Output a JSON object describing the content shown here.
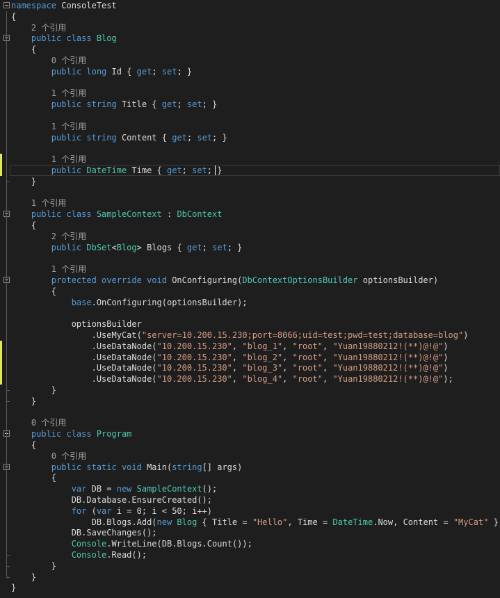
{
  "editor": {
    "lines": [
      [
        [
          "kw",
          "namespace"
        ],
        [
          "pl",
          " ConsoleTest"
        ]
      ],
      [
        [
          "pl",
          "{"
        ]
      ],
      [
        [
          "lens",
          "    2 个引用"
        ]
      ],
      [
        [
          "kw",
          "    public class "
        ],
        [
          "ty",
          "Blog"
        ]
      ],
      [
        [
          "pl",
          "    {"
        ]
      ],
      [
        [
          "lens",
          "        0 个引用"
        ]
      ],
      [
        [
          "kw",
          "        public long "
        ],
        [
          "pl",
          "Id { "
        ],
        [
          "kw",
          "get"
        ],
        [
          "pl",
          "; "
        ],
        [
          "kw",
          "set"
        ],
        [
          "pl",
          "; }"
        ]
      ],
      [
        [
          "pl",
          ""
        ]
      ],
      [
        [
          "lens",
          "        1 个引用"
        ]
      ],
      [
        [
          "kw",
          "        public string "
        ],
        [
          "pl",
          "Title { "
        ],
        [
          "kw",
          "get"
        ],
        [
          "pl",
          "; "
        ],
        [
          "kw",
          "set"
        ],
        [
          "pl",
          "; }"
        ]
      ],
      [
        [
          "pl",
          ""
        ]
      ],
      [
        [
          "lens",
          "        1 个引用"
        ]
      ],
      [
        [
          "kw",
          "        public string "
        ],
        [
          "pl",
          "Content { "
        ],
        [
          "kw",
          "get"
        ],
        [
          "pl",
          "; "
        ],
        [
          "kw",
          "set"
        ],
        [
          "pl",
          "; }"
        ]
      ],
      [
        [
          "pl",
          ""
        ]
      ],
      [
        [
          "lens",
          "        1 个引用"
        ]
      ],
      [
        [
          "kw",
          "        public "
        ],
        [
          "ty",
          "DateTime"
        ],
        [
          "pl",
          " Time { "
        ],
        [
          "kw",
          "get"
        ],
        [
          "pl",
          "; "
        ],
        [
          "kw",
          "set"
        ],
        [
          "pl",
          "; }"
        ]
      ],
      [
        [
          "pl",
          "    }"
        ]
      ],
      [
        [
          "pl",
          ""
        ]
      ],
      [
        [
          "lens",
          "    1 个引用"
        ]
      ],
      [
        [
          "kw",
          "    public class "
        ],
        [
          "ty",
          "SampleContext"
        ],
        [
          "pl",
          " : "
        ],
        [
          "ty",
          "DbContext"
        ]
      ],
      [
        [
          "pl",
          "    {"
        ]
      ],
      [
        [
          "lens",
          "        2 个引用"
        ]
      ],
      [
        [
          "kw",
          "        public "
        ],
        [
          "ty",
          "DbSet"
        ],
        [
          "pl",
          "<"
        ],
        [
          "ty",
          "Blog"
        ],
        [
          "pl",
          "> Blogs { "
        ],
        [
          "kw",
          "get"
        ],
        [
          "pl",
          "; "
        ],
        [
          "kw",
          "set"
        ],
        [
          "pl",
          "; }"
        ]
      ],
      [
        [
          "pl",
          ""
        ]
      ],
      [
        [
          "lens",
          "        1 个引用"
        ]
      ],
      [
        [
          "kw",
          "        protected override void "
        ],
        [
          "pl",
          "OnConfiguring("
        ],
        [
          "ty",
          "DbContextOptionsBuilder"
        ],
        [
          "pl",
          " optionsBuilder)"
        ]
      ],
      [
        [
          "pl",
          "        {"
        ]
      ],
      [
        [
          "kw",
          "            base"
        ],
        [
          "pl",
          ".OnConfiguring(optionsBuilder);"
        ]
      ],
      [
        [
          "pl",
          ""
        ]
      ],
      [
        [
          "pl",
          "            optionsBuilder"
        ]
      ],
      [
        [
          "pl",
          "                .UseMyCat("
        ],
        [
          "st",
          "\"server=10.200.15.230;port=8066;uid=test;pwd=test;database=blog\""
        ],
        [
          "pl",
          ")"
        ]
      ],
      [
        [
          "pl",
          "                .UseDataNode("
        ],
        [
          "st",
          "\"10.200.15.230\""
        ],
        [
          "pl",
          ", "
        ],
        [
          "st",
          "\"blog_1\""
        ],
        [
          "pl",
          ", "
        ],
        [
          "st",
          "\"root\""
        ],
        [
          "pl",
          ", "
        ],
        [
          "st",
          "\"Yuan19880212!(**)@!@\""
        ],
        [
          "pl",
          ")"
        ]
      ],
      [
        [
          "pl",
          "                .UseDataNode("
        ],
        [
          "st",
          "\"10.200.15.230\""
        ],
        [
          "pl",
          ", "
        ],
        [
          "st",
          "\"blog_2\""
        ],
        [
          "pl",
          ", "
        ],
        [
          "st",
          "\"root\""
        ],
        [
          "pl",
          ", "
        ],
        [
          "st",
          "\"Yuan19880212!(**)@!@\""
        ],
        [
          "pl",
          ")"
        ]
      ],
      [
        [
          "pl",
          "                .UseDataNode("
        ],
        [
          "st",
          "\"10.200.15.230\""
        ],
        [
          "pl",
          ", "
        ],
        [
          "st",
          "\"blog_3\""
        ],
        [
          "pl",
          ", "
        ],
        [
          "st",
          "\"root\""
        ],
        [
          "pl",
          ", "
        ],
        [
          "st",
          "\"Yuan19880212!(**)@!@\""
        ],
        [
          "pl",
          ")"
        ]
      ],
      [
        [
          "pl",
          "                .UseDataNode("
        ],
        [
          "st",
          "\"10.200.15.230\""
        ],
        [
          "pl",
          ", "
        ],
        [
          "st",
          "\"blog_4\""
        ],
        [
          "pl",
          ", "
        ],
        [
          "st",
          "\"root\""
        ],
        [
          "pl",
          ", "
        ],
        [
          "st",
          "\"Yuan19880212!(**)@!@\""
        ],
        [
          "pl",
          ");"
        ]
      ],
      [
        [
          "pl",
          "        }"
        ]
      ],
      [
        [
          "pl",
          "    }"
        ]
      ],
      [
        [
          "pl",
          ""
        ]
      ],
      [
        [
          "lens",
          "    0 个引用"
        ]
      ],
      [
        [
          "kw",
          "    public class "
        ],
        [
          "ty",
          "Program"
        ]
      ],
      [
        [
          "pl",
          "    {"
        ]
      ],
      [
        [
          "lens",
          "        0 个引用"
        ]
      ],
      [
        [
          "kw",
          "        public static void "
        ],
        [
          "pl",
          "Main("
        ],
        [
          "kw",
          "string"
        ],
        [
          "pl",
          "[] args)"
        ]
      ],
      [
        [
          "pl",
          "        {"
        ]
      ],
      [
        [
          "kw",
          "            var "
        ],
        [
          "pl",
          "DB = "
        ],
        [
          "kw",
          "new "
        ],
        [
          "ty",
          "SampleContext"
        ],
        [
          "pl",
          "();"
        ]
      ],
      [
        [
          "pl",
          "            DB.Database.EnsureCreated();"
        ]
      ],
      [
        [
          "kw",
          "            for "
        ],
        [
          "pl",
          "("
        ],
        [
          "kw",
          "var"
        ],
        [
          "pl",
          " i = 0; i < 50; i++)"
        ]
      ],
      [
        [
          "pl",
          "                DB.Blogs.Add("
        ],
        [
          "kw",
          "new "
        ],
        [
          "ty",
          "Blog"
        ],
        [
          "pl",
          " { Title = "
        ],
        [
          "st",
          "\"Hello\""
        ],
        [
          "pl",
          ", Time = "
        ],
        [
          "ty",
          "DateTime"
        ],
        [
          "pl",
          ".Now, Content = "
        ],
        [
          "st",
          "\"MyCat\""
        ],
        [
          "pl",
          " });"
        ]
      ],
      [
        [
          "pl",
          "            DB.SaveChanges();"
        ]
      ],
      [
        [
          "ty",
          "            Console"
        ],
        [
          "pl",
          ".WriteLine(DB.Blogs.Count());"
        ]
      ],
      [
        [
          "ty",
          "            Console"
        ],
        [
          "pl",
          ".Read();"
        ]
      ],
      [
        [
          "pl",
          "        }"
        ]
      ],
      [
        [
          "pl",
          "    }"
        ]
      ],
      [
        [
          "pl",
          "}"
        ]
      ]
    ],
    "current_line": 15
  }
}
